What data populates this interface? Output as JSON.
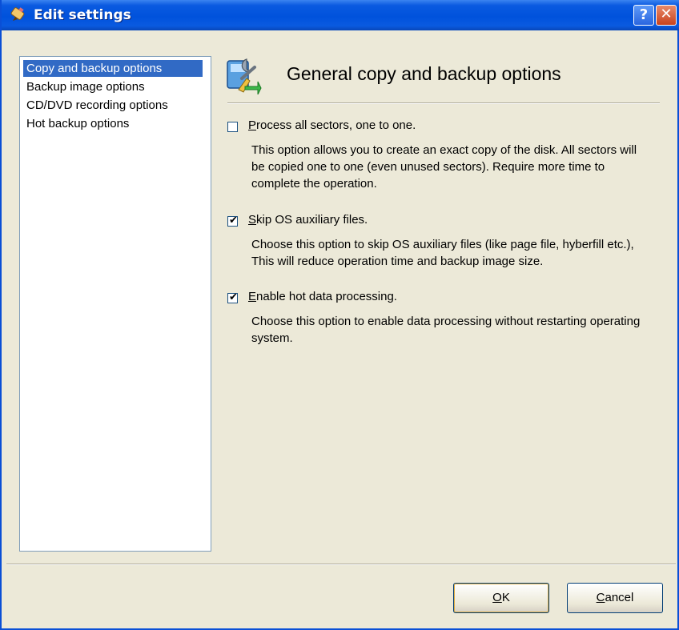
{
  "window": {
    "title": "Edit settings",
    "help_glyph": "?",
    "close_glyph": "✕"
  },
  "sidebar": {
    "items": [
      {
        "label": "Copy and backup options",
        "selected": true
      },
      {
        "label": "Backup image options",
        "selected": false
      },
      {
        "label": "CD/DVD recording options",
        "selected": false
      },
      {
        "label": "Hot backup options",
        "selected": false
      }
    ]
  },
  "main": {
    "heading": "General copy and backup options",
    "options": [
      {
        "mnemonic": "P",
        "label_rest": "rocess all sectors, one to one.",
        "checked": false,
        "description": "This option allows you to create an exact copy of the disk. All sectors will be copied one to one (even unused sectors). Require more time to complete the operation."
      },
      {
        "mnemonic": "S",
        "label_rest": "kip OS auxiliary files.",
        "checked": true,
        "description": "Choose this option to skip OS auxiliary files (like page file, hyberfill etc.), This will reduce operation time and backup image size."
      },
      {
        "mnemonic": "E",
        "label_rest": "nable hot data processing.",
        "checked": true,
        "description": "Choose this option to enable data processing without restarting operating system."
      }
    ]
  },
  "footer": {
    "ok_mnemonic": "O",
    "ok_rest": "K",
    "cancel_mnemonic": "C",
    "cancel_rest": "ancel"
  },
  "colors": {
    "titlebar": "#0052dc",
    "selection": "#316ac5",
    "dialog_bg": "#ece9d8"
  },
  "icons": {
    "title": "pencil-icon",
    "header": "settings-wrench-icon"
  }
}
